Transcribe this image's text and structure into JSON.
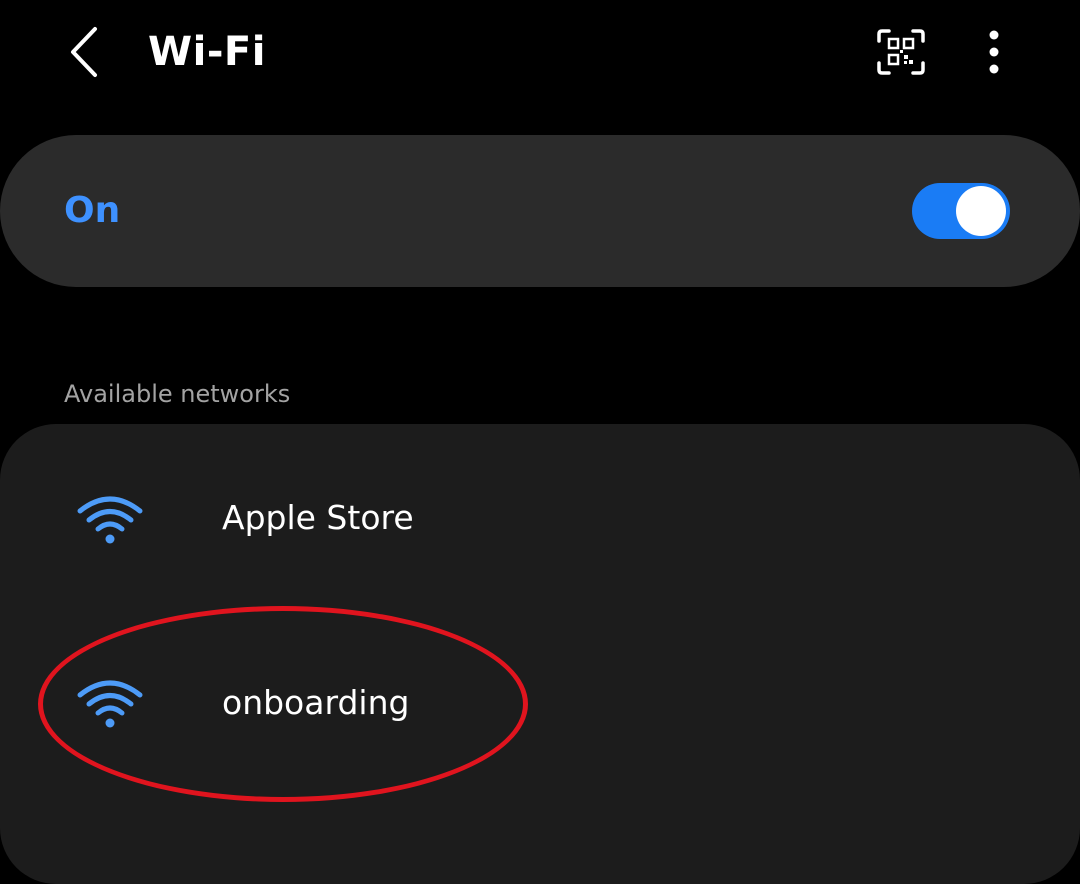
{
  "header": {
    "title": "Wi-Fi",
    "icons": {
      "back": "chevron-left-icon",
      "qr": "qr-scan-icon",
      "more": "more-vertical-icon"
    }
  },
  "toggle": {
    "label": "On",
    "state": true
  },
  "networks": {
    "section_label": "Available networks",
    "items": [
      {
        "name": "Apple Store",
        "icon": "wifi-icon"
      },
      {
        "name": "onboarding",
        "icon": "wifi-icon"
      }
    ]
  },
  "colors": {
    "accent": "#3e91ff",
    "switch_on": "#1a7cf5",
    "wifi_icon": "#4d9bf7",
    "annotation": "#e0141e"
  }
}
